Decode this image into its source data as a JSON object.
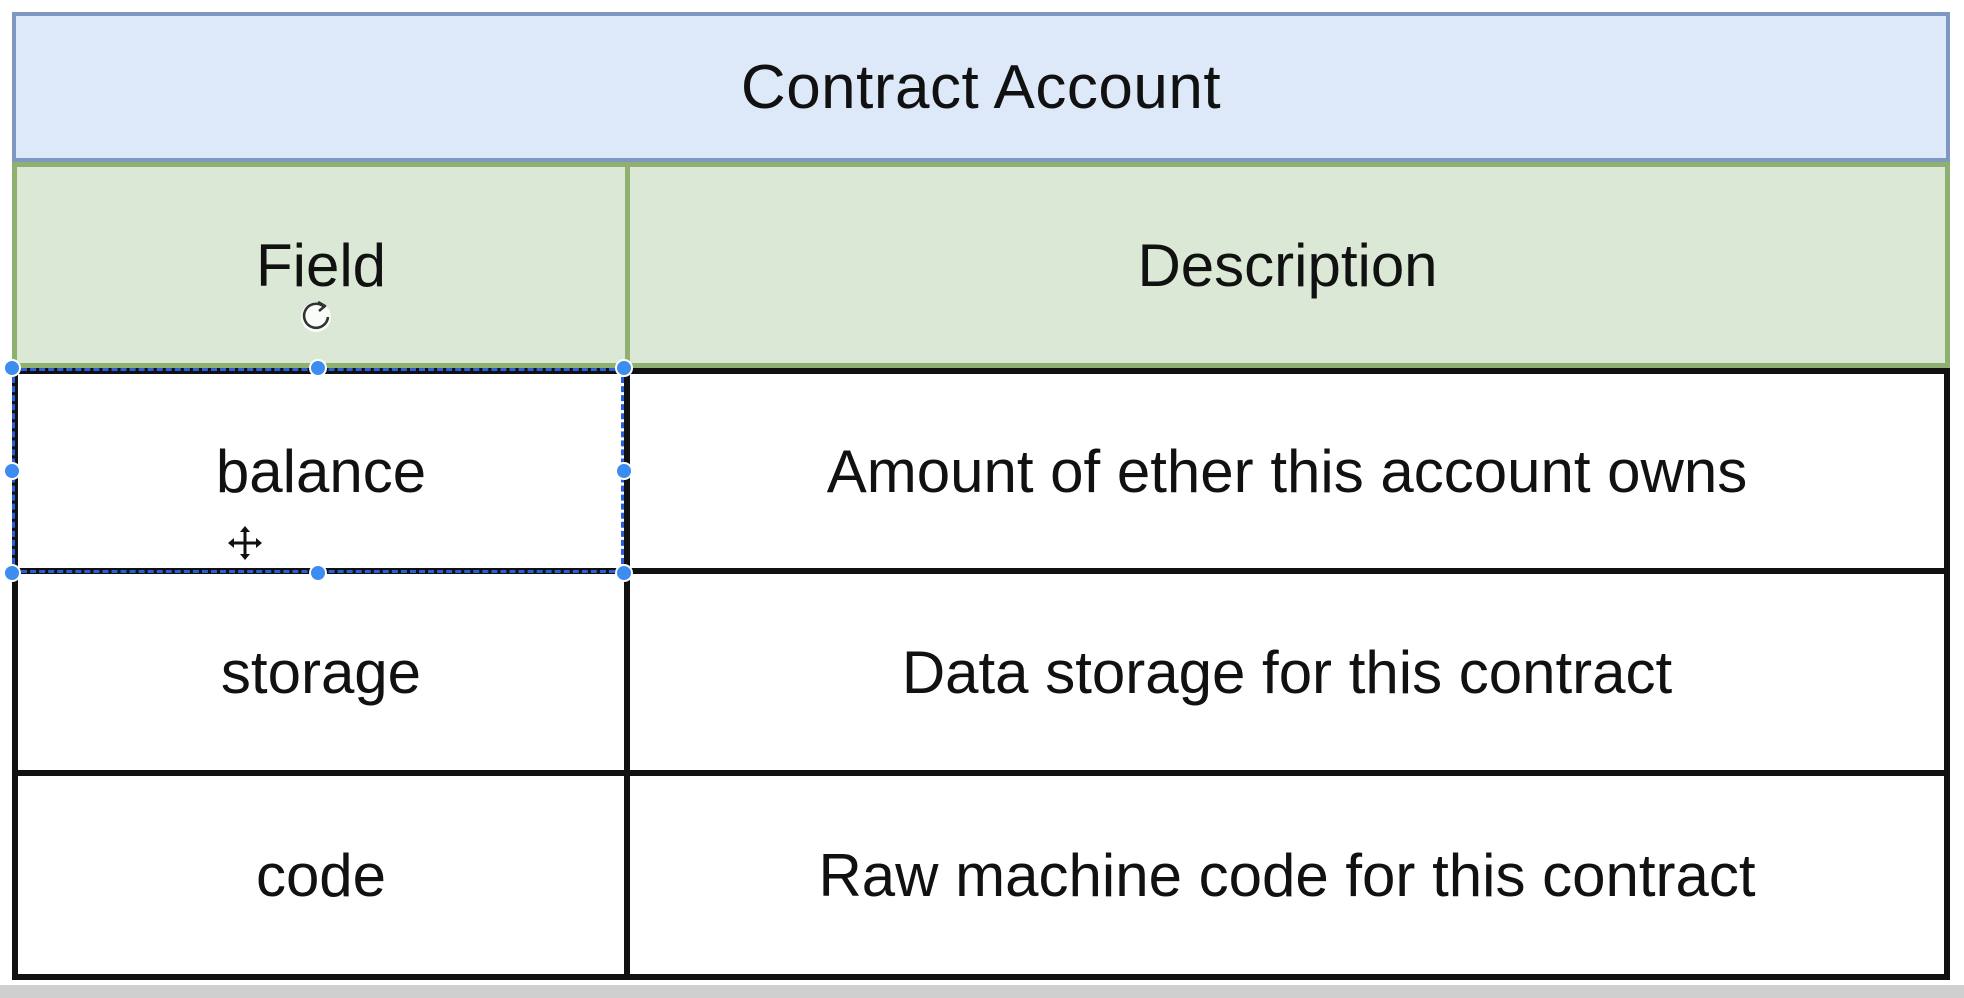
{
  "table": {
    "title": "Contract Account",
    "headers": {
      "field": "Field",
      "description": "Description"
    },
    "rows": [
      {
        "field": "balance",
        "description": "Amount of ether this account owns"
      },
      {
        "field": "storage",
        "description": "Data storage for this contract"
      },
      {
        "field": "code",
        "description": "Raw machine code for this contract"
      }
    ]
  },
  "colors": {
    "title_fill": "#dde9f8",
    "title_border": "#7e98c2",
    "header_fill": "#dbe8d5",
    "header_border": "#8fb070",
    "selection_handle": "#3d8cf0"
  },
  "icons": {
    "rotate": "rotate-handle-icon",
    "move": "move-cursor-icon"
  }
}
